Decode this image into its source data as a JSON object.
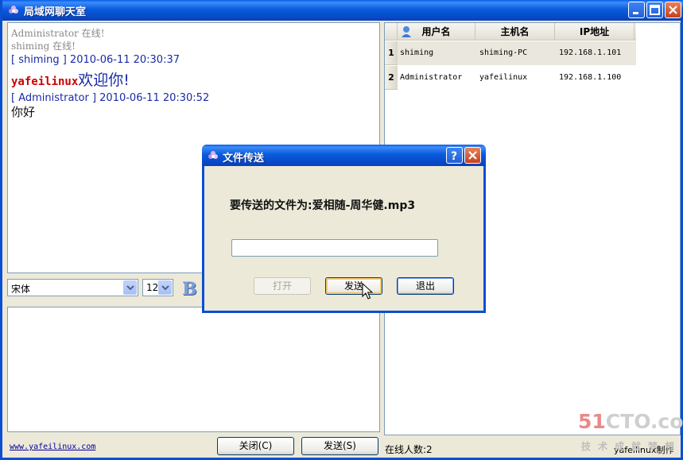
{
  "window": {
    "title": "局域网聊天室",
    "icons": {
      "app": "app-flower-icon",
      "minimize": "minimize-icon",
      "maximize": "maximize-icon",
      "close": "close-icon"
    }
  },
  "chat": {
    "system_lines": [
      "Administrator 在线!",
      "shiming 在线!"
    ],
    "messages": [
      {
        "header": "[ shiming ] 2010-06-11 20:30:37",
        "name": "yafeilinux",
        "text": "欢迎你!"
      },
      {
        "header": "[ Administrator ] 2010-06-11 20:30:52",
        "text": "你好"
      }
    ]
  },
  "toolbar": {
    "font": "宋体",
    "size": "12",
    "bold_label": "B"
  },
  "footer": {
    "link": "www.yafeilinux.com",
    "close_button": "关闭(C)",
    "send_button": "发送(S)",
    "online_count": "在线人数:2",
    "credit": "yafeilinux制作"
  },
  "users": {
    "columns": [
      "用户名",
      "主机名",
      "IP地址"
    ],
    "rows": [
      {
        "index": "1",
        "username": "shiming",
        "hostname": "shiming-PC",
        "ip": "192.168.1.101"
      },
      {
        "index": "2",
        "username": "Administrator",
        "hostname": "yafeilinux",
        "ip": "192.168.1.100"
      }
    ]
  },
  "dialog": {
    "title": "文件传送",
    "message": "要传送的文件为:爱相随-周华健.mp3",
    "path_value": "",
    "open_button": "打开",
    "send_button": "发送",
    "exit_button": "退出",
    "icons": {
      "help": "help-icon",
      "close": "close-icon"
    }
  },
  "watermark": {
    "brand_a": "51",
    "brand_b": "CTO",
    "brand_c": ".com",
    "tagline": "技术成就梦想"
  }
}
